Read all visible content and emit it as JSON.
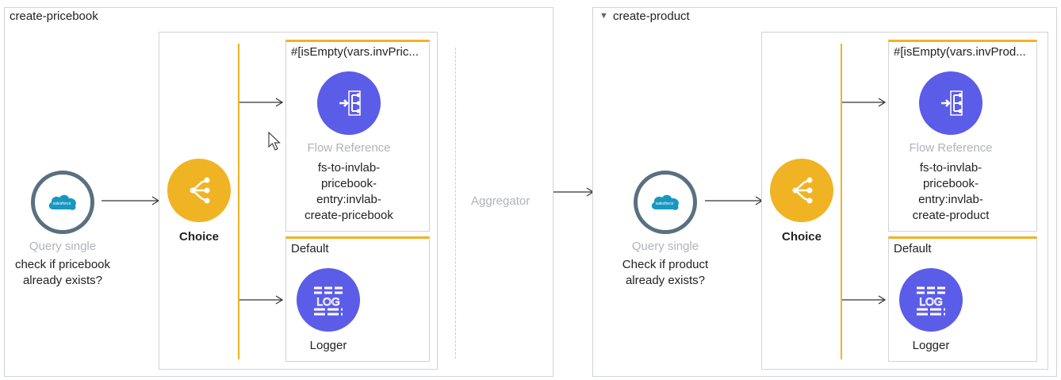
{
  "flows": {
    "pricebook": {
      "title": "create-pricebook",
      "query": {
        "type_label": "Query single",
        "name": "check if pricebook already exists?"
      },
      "choice_label": "Choice",
      "route1": {
        "label": "#[isEmpty(vars.invPric...",
        "type_label": "Flow Reference",
        "name": "fs-to-invlab-pricebook-entry:invlab-create-pricebook"
      },
      "route2": {
        "label": "Default",
        "name": "Logger"
      }
    },
    "aggregator_label": "Aggregator",
    "product": {
      "collapse_glyph": "▼",
      "title": "create-product",
      "query": {
        "type_label": "Query single",
        "name": "Check if product already exists?"
      },
      "choice_label": "Choice",
      "route1": {
        "label": "#[isEmpty(vars.invProd...",
        "type_label": "Flow Reference",
        "name": "fs-to-invlab-pricebook-entry:invlab-create-product"
      },
      "route2": {
        "label": "Default",
        "name": "Logger"
      }
    }
  },
  "colors": {
    "choice": "#f0b323",
    "component": "#5b5ce8",
    "salesforce_ring": "#5a7080",
    "salesforce_cloud": "#1798c1"
  },
  "icons": {
    "salesforce": "salesforce-cloud-icon",
    "choice": "branch-icon",
    "flow_ref": "flow-reference-icon",
    "logger": "logger-icon"
  },
  "salesforce_text": "salesforce"
}
